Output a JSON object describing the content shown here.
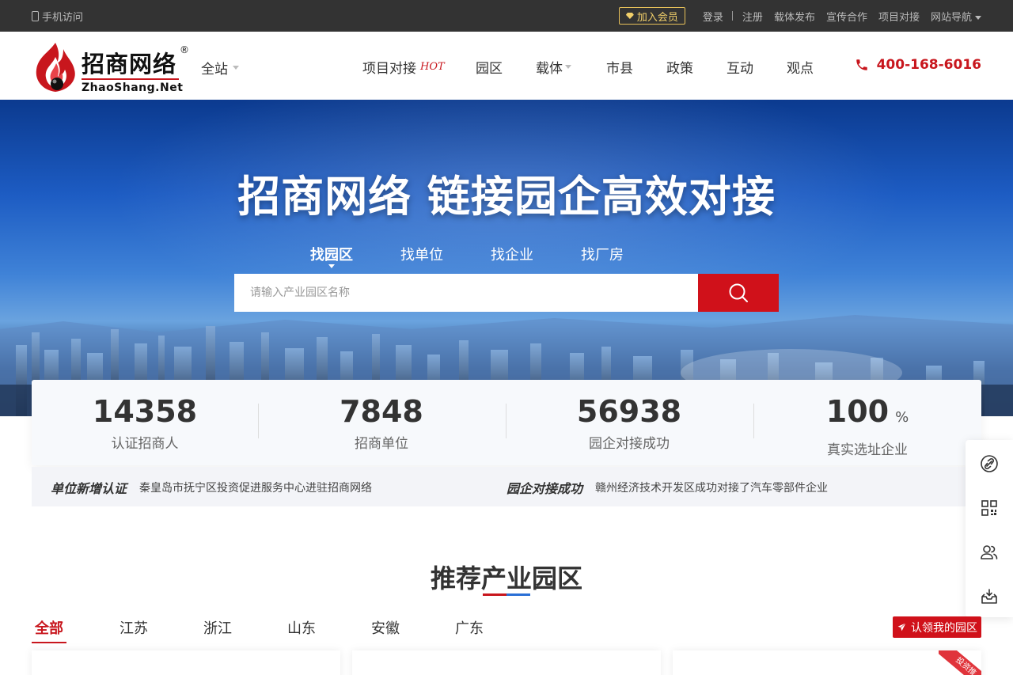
{
  "topbar": {
    "mobile_label": "手机访问",
    "member_label": "加入会员",
    "links": [
      "登录",
      "注册",
      "载体发布",
      "宣传合作",
      "项目对接",
      "网站导航"
    ]
  },
  "header": {
    "logo_cn": "招商网络",
    "logo_en": "ZhaoShang.Net",
    "logo_reg": "®",
    "site_select": "全站",
    "nav": [
      {
        "label": "项目对接",
        "badge": "HOT"
      },
      {
        "label": "园区"
      },
      {
        "label": "载体"
      },
      {
        "label": "市县"
      },
      {
        "label": "政策"
      },
      {
        "label": "互动"
      },
      {
        "label": "观点"
      }
    ],
    "hotline": "400-168-6016"
  },
  "banner": {
    "headline": "招商网络 链接园企高效对接",
    "tabs": [
      "找园区",
      "找单位",
      "找企业",
      "找厂房"
    ],
    "search_placeholder": "请输入产业园区名称"
  },
  "stats": [
    {
      "value": "14358",
      "label": "认证招商人"
    },
    {
      "value": "7848",
      "label": "招商单位"
    },
    {
      "value": "56938",
      "label": "园企对接成功"
    },
    {
      "value": "100",
      "unit": "%",
      "label": "真实选址企业"
    }
  ],
  "ticker": [
    {
      "tag": "单位新增认证",
      "message": "秦皇岛市抚宁区投资促进服务中心进驻招商网络"
    },
    {
      "tag": "园企对接成功",
      "message": "赣州经济技术开发区成功对接了汽车零部件企业"
    }
  ],
  "sidebar": [
    "link-icon",
    "qrcode-icon",
    "users-icon",
    "inbox-icon"
  ],
  "recommend": {
    "title": "推荐产业园区",
    "regions": [
      "全部",
      "江苏",
      "浙江",
      "山东",
      "安徽",
      "广东"
    ],
    "claim_label": "认领我的园区",
    "ribbon": "投资推"
  },
  "colors": {
    "brand_red": "#c8161d",
    "button_red": "#d0111a",
    "topbar_bg": "#333333",
    "accent_blue": "#2a6fd6"
  }
}
